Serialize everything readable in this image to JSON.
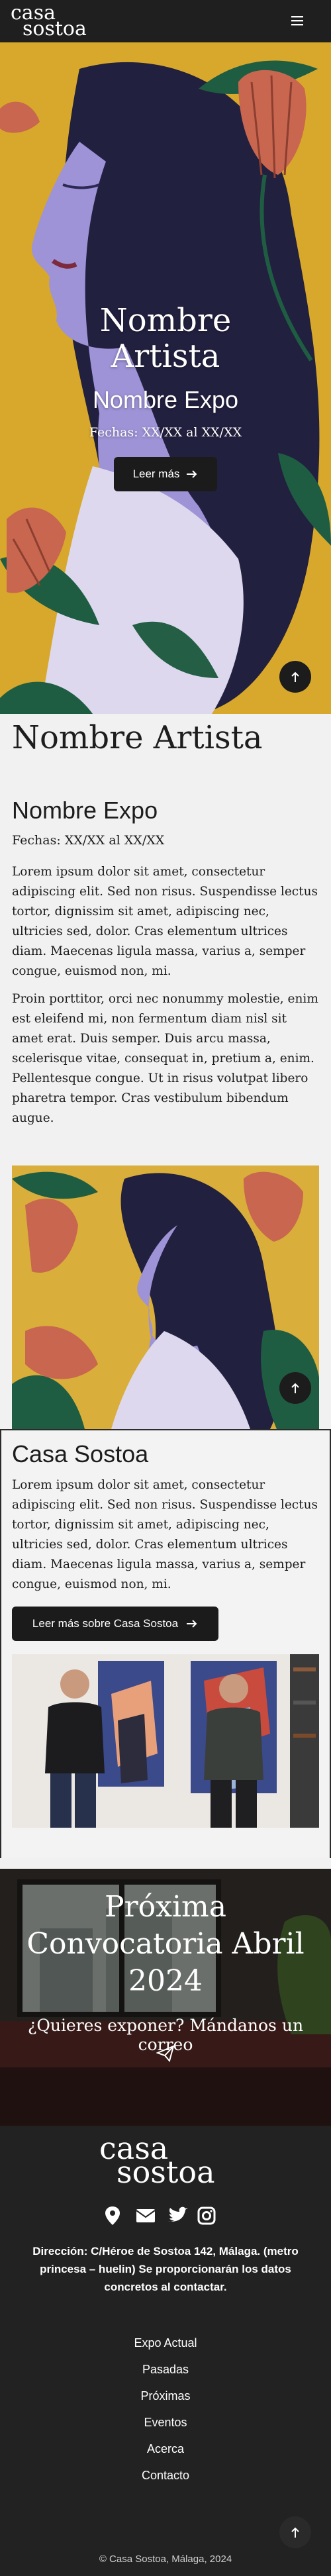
{
  "header": {
    "logo_line1": "casa",
    "logo_line2": "sostoa",
    "menu_icon": "hamburger-icon"
  },
  "hero": {
    "artist_name_line1": "Nombre",
    "artist_name_line2": "Artista",
    "expo_name": "Nombre Expo",
    "dates": "Fechas: XX/XX al XX/XX",
    "button_label": "Leer más",
    "button_icon": "arrow-right-icon",
    "scroll_top_icon": "arrow-up-icon"
  },
  "artist_section": {
    "title": "Nombre Artista",
    "expo_title": "Nombre Expo",
    "dates": "Fechas: XX/XX al XX/XX",
    "paragraph1": "Lorem ipsum dolor sit amet, consectetur adipiscing elit. Sed non risus. Suspendisse lectus tortor, dignissim sit amet, adipiscing nec, ultricies sed, dolor. Cras elementum ultrices diam. Maecenas ligula massa, varius a, semper congue, euismod non, mi.",
    "paragraph2": "Proin porttitor, orci nec nonummy molestie, enim est eleifend mi, non fermentum diam nisl sit amet erat. Duis semper. Duis arcu massa, scelerisque vitae, consequat in, pretium a, enim. Pellentesque congue. Ut in risus volutpat libero pharetra tempor. Cras vestibulum bibendum augue."
  },
  "casa_section": {
    "title": "Casa Sostoa",
    "paragraph": "Lorem ipsum dolor sit amet, consectetur adipiscing elit. Sed non risus. Suspendisse lectus tortor, dignissim sit amet, adipiscing nec, ultricies sed, dolor. Cras elementum ultrices diam. Maecenas ligula massa, varius a, semper congue, euismod non, mi.",
    "button_label": "Leer más sobre Casa Sostoa"
  },
  "convocatoria": {
    "title_line1": "Próxima",
    "title_line2": "Convocatoria Abril",
    "title_line3": "2024",
    "subtitle": "¿Quieres exponer? Mándanos un correo",
    "send_icon": "paper-plane-icon"
  },
  "footer": {
    "logo_line1": "casa",
    "logo_line2": "sostoa",
    "social_icons": [
      "map-pin-icon",
      "envelope-icon",
      "twitter-icon",
      "instagram-icon"
    ],
    "address_line1": "Dirección: C/Héroe de Sostoa 142, Málaga. (metro",
    "address_line2": "princesa – huelin) Se proporcionarán los datos",
    "address_line3": "concretos al contactar.",
    "nav": [
      "Expo Actual",
      "Pasadas",
      "Próximas",
      "Eventos",
      "Acerca",
      "Contacto"
    ],
    "copyright": "© Casa Sostoa, Málaga, 2024"
  },
  "colors": {
    "dark": "#1f1f1f",
    "mustard": "#d7a82b",
    "leaf_green": "#1f5d43",
    "flower_coral": "#c9664f",
    "face_lilac": "#9d93d6"
  }
}
